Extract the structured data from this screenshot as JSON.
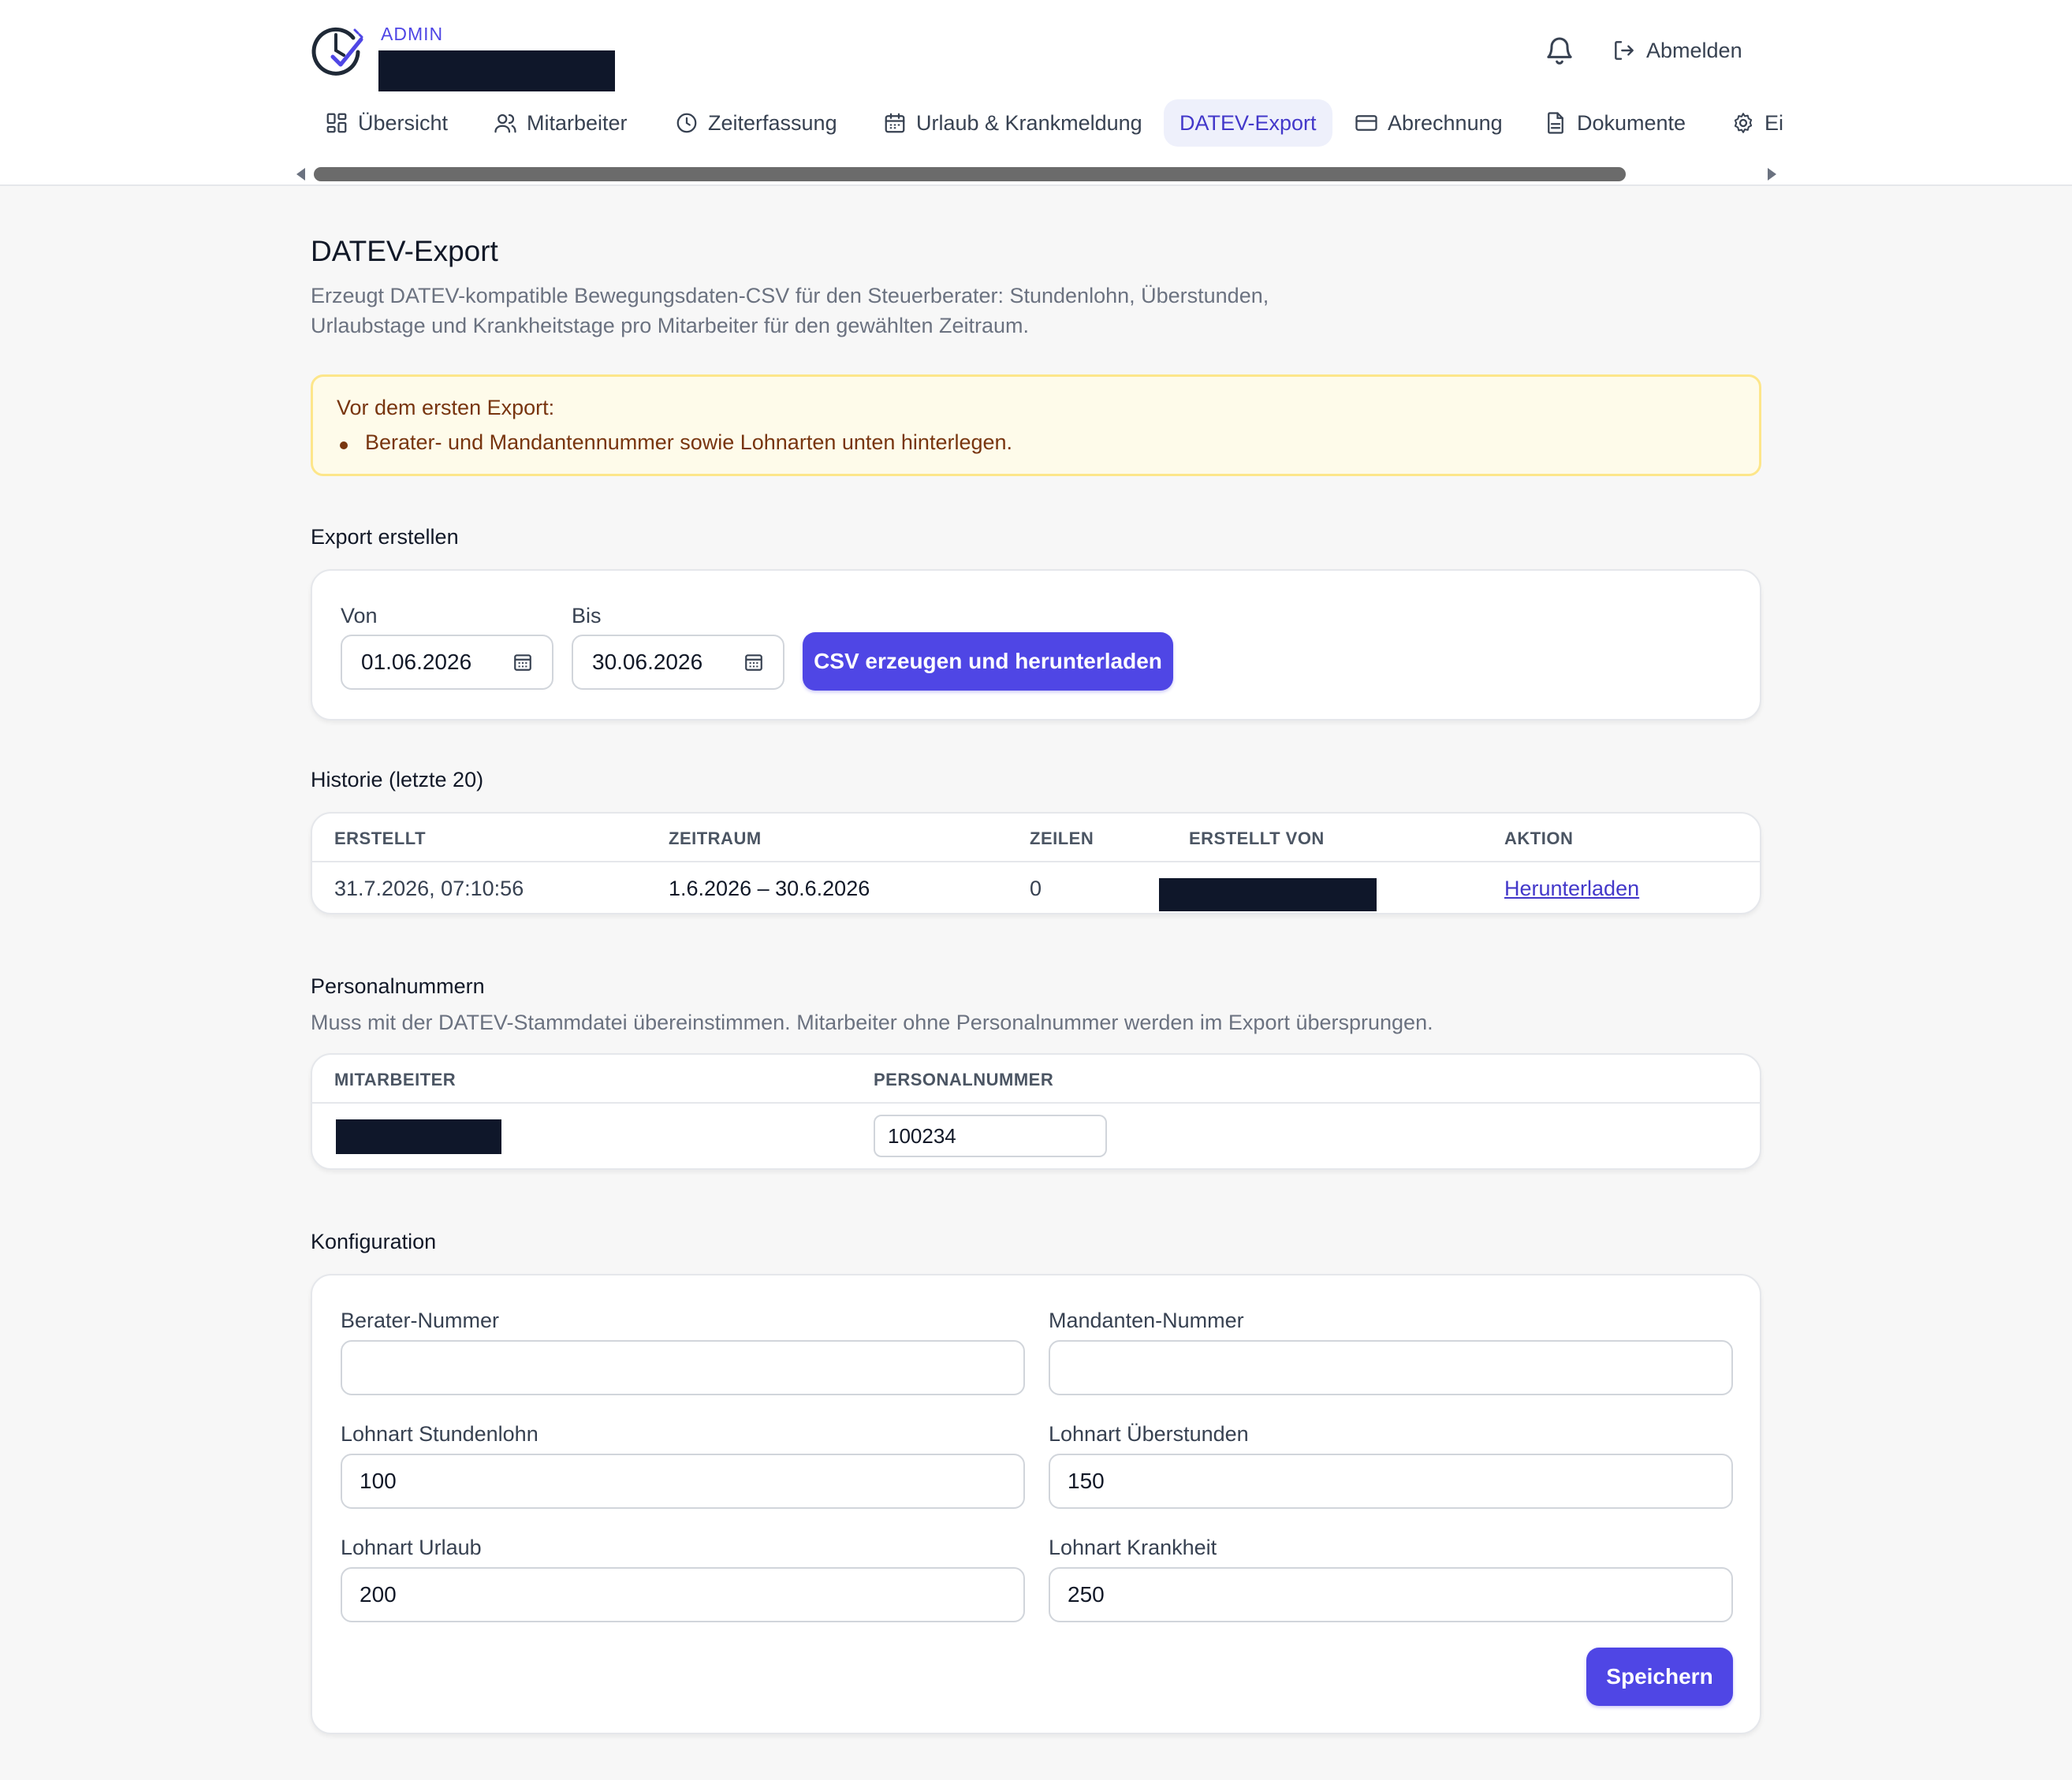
{
  "header": {
    "role": "ADMIN",
    "logout_label": "Abmelden"
  },
  "nav": {
    "tabs": [
      {
        "label": "Übersicht",
        "icon": "dashboard-icon"
      },
      {
        "label": "Mitarbeiter",
        "icon": "users-icon"
      },
      {
        "label": "Zeiterfassung",
        "icon": "clock-icon"
      },
      {
        "label": "Urlaub & Krankmeldung",
        "icon": "calendar-icon"
      },
      {
        "label": "DATEV-Export",
        "icon": "",
        "active": true
      },
      {
        "label": "Abrechnung",
        "icon": "credit-card-icon"
      },
      {
        "label": "Dokumente",
        "icon": "document-icon"
      },
      {
        "label": "Ei",
        "icon": "gear-icon"
      }
    ]
  },
  "page": {
    "title": "DATEV-Export",
    "description": "Erzeugt DATEV-kompatible Bewegungsdaten-CSV für den Steuerberater: Stundenlohn, Überstunden, Urlaubstage und Krankheitstage pro Mitarbeiter für den gewählten Zeitraum."
  },
  "warning": {
    "title": "Vor dem ersten Export:",
    "items": [
      "Berater- und Mandantennummer sowie Lohnarten unten hinterlegen."
    ]
  },
  "export": {
    "heading": "Export erstellen",
    "from_label": "Von",
    "from_value": "01.06.2026",
    "to_label": "Bis",
    "to_value": "30.06.2026",
    "button_label": "CSV erzeugen und herunterladen"
  },
  "history": {
    "heading": "Historie (letzte 20)",
    "columns": [
      "ERSTELLT",
      "ZEITRAUM",
      "ZEILEN",
      "ERSTELLT VON",
      "AKTION"
    ],
    "rows": [
      {
        "created": "31.7.2026, 07:10:56",
        "period": "1.6.2026 – 30.6.2026",
        "rows": "0",
        "action": "Herunterladen"
      }
    ]
  },
  "personnel": {
    "heading": "Personalnummern",
    "description": "Muss mit der DATEV-Stammdatei übereinstimmen. Mitarbeiter ohne Personalnummer werden im Export übersprungen.",
    "columns": [
      "MITARBEITER",
      "PERSONALNUMMER"
    ],
    "rows": [
      {
        "number": "100234"
      }
    ]
  },
  "config": {
    "heading": "Konfiguration",
    "advisor_label": "Berater-Nummer",
    "advisor_value": "",
    "client_label": "Mandanten-Nummer",
    "client_value": "",
    "wage_label": "Lohnart Stundenlohn",
    "wage_value": "100",
    "overtime_label": "Lohnart Überstunden",
    "overtime_value": "150",
    "vacation_label": "Lohnart Urlaub",
    "vacation_value": "200",
    "sick_label": "Lohnart Krankheit",
    "sick_value": "250",
    "save_label": "Speichern"
  },
  "colors": {
    "accent": "#4f46e5",
    "warning_bg": "#fefbea",
    "warning_border": "#fde68a",
    "redaction": "#0f172a"
  }
}
